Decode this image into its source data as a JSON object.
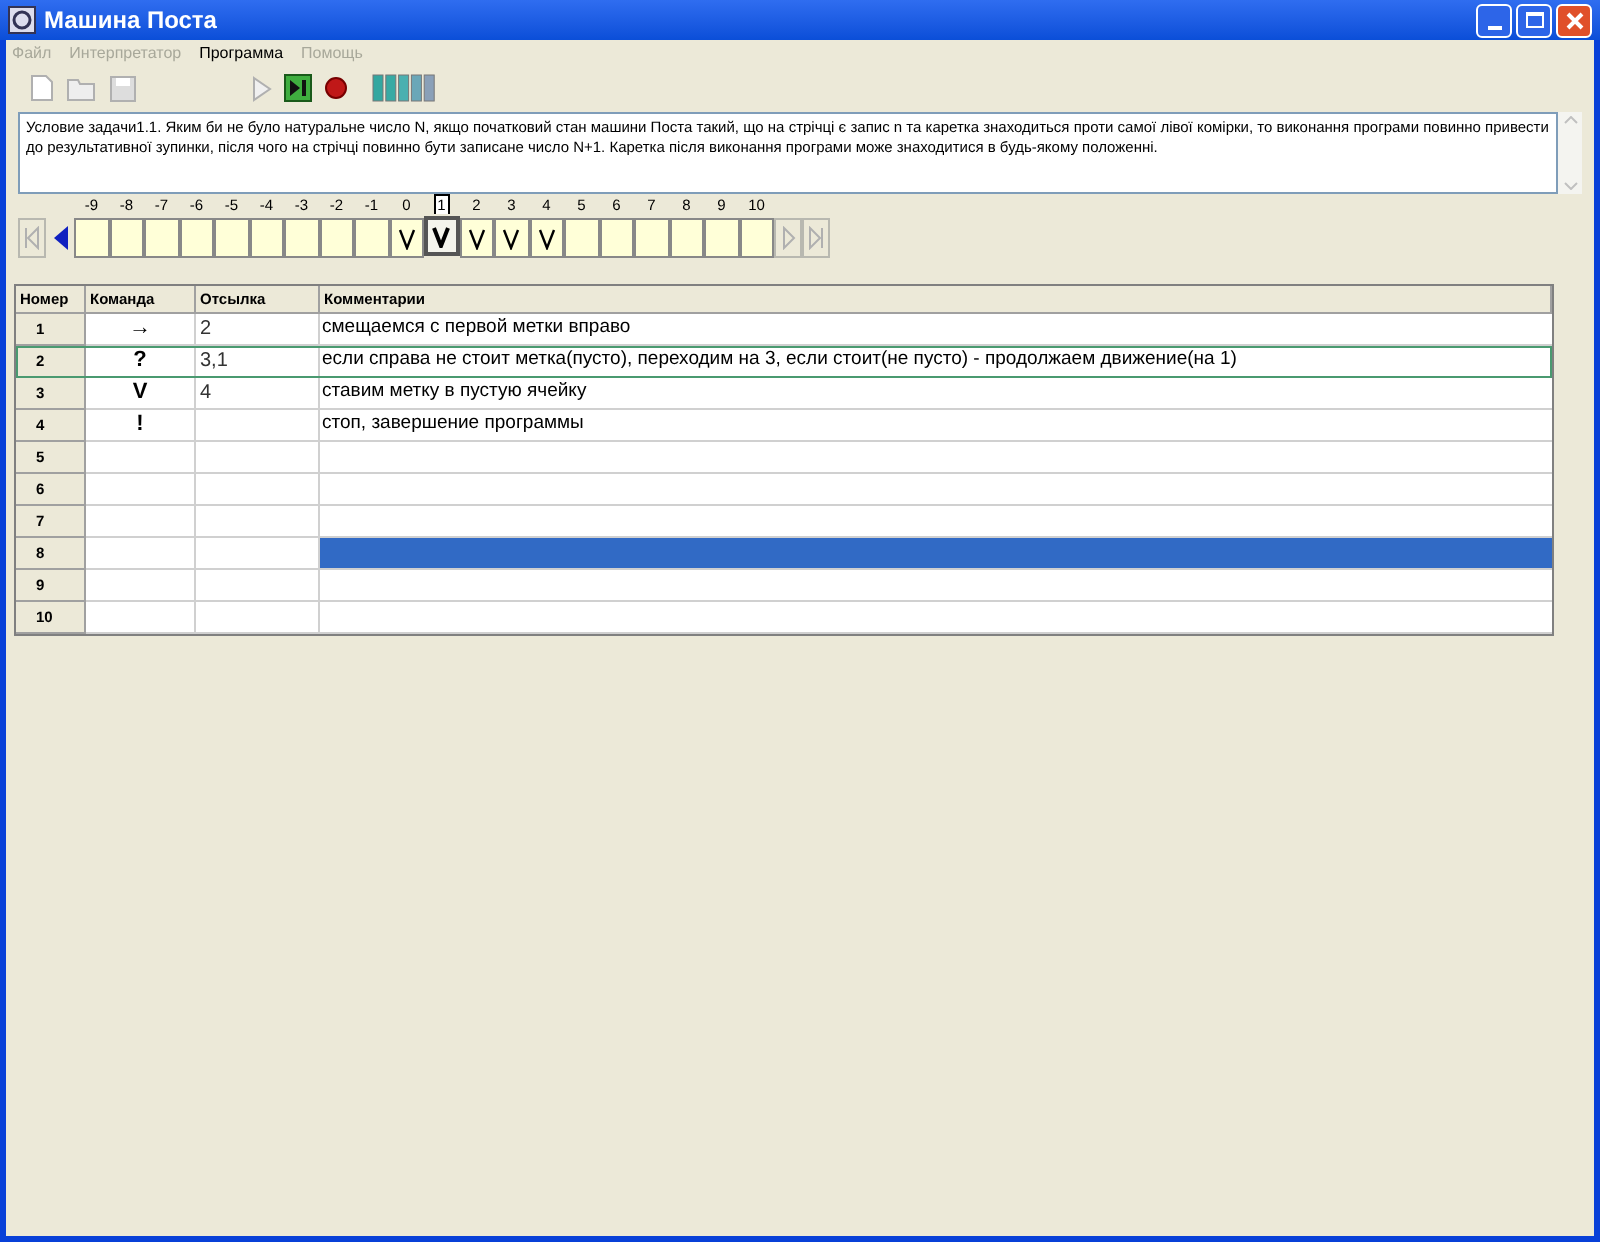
{
  "window": {
    "title": "Машина Поста"
  },
  "menu": [
    {
      "label": "Файл",
      "disabled": true
    },
    {
      "label": "Интерпретатор",
      "disabled": true
    },
    {
      "label": "Программа",
      "disabled": false
    },
    {
      "label": "Помощь",
      "disabled": true
    }
  ],
  "toolbar": [
    {
      "kind": "new",
      "disabled": true
    },
    {
      "kind": "open",
      "disabled": true
    },
    {
      "kind": "save",
      "disabled": true
    },
    {
      "kind": "run",
      "disabled": true
    },
    {
      "kind": "step",
      "disabled": false
    },
    {
      "kind": "stop",
      "disabled": false
    },
    {
      "kind": "speed",
      "disabled": false
    }
  ],
  "task": "Условие задачи1.1. Яким би не було натуральне число N, якщо початковий стан машини Поста такий, що на стрічці є запис n та каретка знаходиться проти самої лівої комірки, то виконання програми повинно привести до результативної зупинки, після чого на стрічці повинно бути записане число N+1. Каретка після виконання програми може знаходитися в будь-якому положенні.",
  "tape": [
    {
      "index": "-9",
      "marked": false,
      "selected": false
    },
    {
      "index": "-8",
      "marked": false,
      "selected": false
    },
    {
      "index": "-7",
      "marked": false,
      "selected": false
    },
    {
      "index": "-6",
      "marked": false,
      "selected": false
    },
    {
      "index": "-5",
      "marked": false,
      "selected": false
    },
    {
      "index": "-4",
      "marked": false,
      "selected": false
    },
    {
      "index": "-3",
      "marked": false,
      "selected": false
    },
    {
      "index": "-2",
      "marked": false,
      "selected": false
    },
    {
      "index": "-1",
      "marked": false,
      "selected": false
    },
    {
      "index": "0",
      "marked": true,
      "selected": false
    },
    {
      "index": "1",
      "marked": true,
      "selected": true
    },
    {
      "index": "2",
      "marked": true,
      "selected": false
    },
    {
      "index": "3",
      "marked": true,
      "selected": false
    },
    {
      "index": "4",
      "marked": true,
      "selected": false
    },
    {
      "index": "5",
      "marked": false,
      "selected": false
    },
    {
      "index": "6",
      "marked": false,
      "selected": false
    },
    {
      "index": "7",
      "marked": false,
      "selected": false
    },
    {
      "index": "8",
      "marked": false,
      "selected": false
    },
    {
      "index": "9",
      "marked": false,
      "selected": false
    },
    {
      "index": "10",
      "marked": false,
      "selected": false
    }
  ],
  "table": {
    "columns": [
      "Номер",
      "Команда",
      "Отсылка",
      "Комментарии"
    ],
    "rows": [
      {
        "number": "1",
        "command": "→",
        "reference": "2",
        "comment": "смещаемся с первой метки вправо",
        "selected": false,
        "current_cell": false
      },
      {
        "number": "2",
        "command": "?",
        "reference": "3,1",
        "comment": "если справа не стоит метка(пусто), переходим на 3, если стоит(не пусто) - продолжаем движение(на 1)",
        "selected": true,
        "current_cell": false
      },
      {
        "number": "3",
        "command": "V",
        "reference": "4",
        "comment": "ставим метку в пустую ячейку",
        "selected": false,
        "current_cell": false
      },
      {
        "number": "4",
        "command": "!",
        "reference": "",
        "comment": "стоп, завершение программы",
        "selected": false,
        "current_cell": false
      },
      {
        "number": "5",
        "command": "",
        "reference": "",
        "comment": "",
        "selected": false,
        "current_cell": false
      },
      {
        "number": "6",
        "command": "",
        "reference": "",
        "comment": "",
        "selected": false,
        "current_cell": false
      },
      {
        "number": "7",
        "command": "",
        "reference": "",
        "comment": "",
        "selected": false,
        "current_cell": false
      },
      {
        "number": "8",
        "command": "",
        "reference": "",
        "comment": "",
        "selected": false,
        "current_cell": true
      },
      {
        "number": "9",
        "command": "",
        "reference": "",
        "comment": "",
        "selected": false,
        "current_cell": false
      },
      {
        "number": "10",
        "command": "",
        "reference": "",
        "comment": "",
        "selected": false,
        "current_cell": false
      }
    ]
  }
}
